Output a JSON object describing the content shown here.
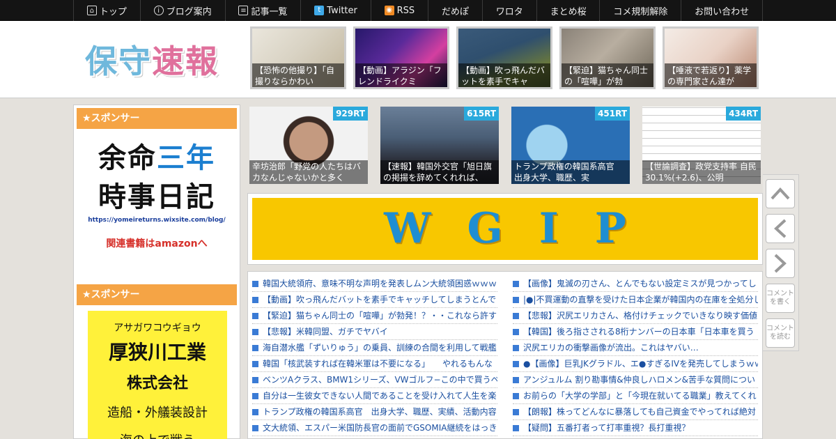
{
  "nav": [
    {
      "label": "トップ",
      "icon": "home-icon"
    },
    {
      "label": "ブログ案内",
      "icon": "info-icon"
    },
    {
      "label": "記事一覧",
      "icon": "list-icon"
    },
    {
      "label": "Twitter",
      "icon": "twitter-icon"
    },
    {
      "label": "RSS",
      "icon": "rss-icon"
    },
    {
      "label": "だめぽ"
    },
    {
      "label": "ワロタ"
    },
    {
      "label": "まとめ桜"
    },
    {
      "label": "コメ規制解除"
    },
    {
      "label": "お問い合わせ"
    }
  ],
  "logo": {
    "part1": "保守",
    "part2": "速報"
  },
  "header_thumbs": [
    {
      "caption": "【恐怖の他撮り】「自撮りならかわい"
    },
    {
      "caption": "【動画】アラジン「フレンドライクミ"
    },
    {
      "caption": "【動画】吹っ飛んだバットを素手でキャ"
    },
    {
      "caption": "【緊迫】猫ちゃん同士の「喧嘩」が勃"
    },
    {
      "caption": "【唾液で若返り】薬学の専門家さん達が"
    }
  ],
  "sidebar": {
    "sponsor_label": "★スポンサー",
    "ad1": {
      "line1a": "余命",
      "line1b": "三年",
      "line2": "時事日記",
      "url": "https://yomeireturns.wixsite.com/blog/",
      "link": "関連書籍はamazonへ"
    },
    "ad2": {
      "kana": "アサガワコウギョウ",
      "company": "厚狭川工業",
      "type": "株式会社",
      "service": "造船・外艤装設計",
      "extra": "海の上で戦う"
    }
  },
  "popular": [
    {
      "rt": "929RT",
      "caption": "辛坊治郎「野党の人たちはバカなんじゃないかと多く"
    },
    {
      "rt": "615RT",
      "caption": "【速報】韓国外交官「旭日旗の掲揚を辞めてくれれば、"
    },
    {
      "rt": "451RT",
      "caption": "トランプ政権の韓国系高官　出身大学、職歴、実"
    },
    {
      "rt": "434RT",
      "caption": "【世論調査】政党支持率 自民30.1%(+2.6)、公明"
    }
  ],
  "banner": {
    "text": "WGIP"
  },
  "news_left": [
    "韓国大統領府、意味不明な声明を発表しムン大統領困惑ｗｗｗ",
    "【動画】吹っ飛んだバットを素手でキャッチしてしまうとんで",
    "【緊迫】猫ちゃん同士の「喧嘩」が勃発！？・・これなら許す",
    "【悲報】米韓同盟、ガチでヤバイ",
    "海自潜水艦「ずいりゅう」の乗員、訓練の合間を利用して戦艦",
    "韓国「核武装すれば在韓米軍は不要になる」　　やれるもんな",
    "ベンツAクラス、BMW1シリーズ、VWゴルフ−この中で買うべ",
    "自分は一生彼女できない人間であることを受け入れて人生を楽",
    "トランプ政権の韓国系高官　出身大学、職歴、実績、活動内容",
    "文大統領、エスパー米国防長官の面前でGSOMIA継続をはっき"
  ],
  "news_right": [
    "【画像】鬼滅の刃さん、とんでもない設定ミスが見つかってし",
    "|●|不買運動の直撃を受けた日本企業が韓国内の在庫を全処分し",
    "【悲報】沢尻エリカさん、格付けチェックでいきなり映す価値",
    "【韓国】後ろ指さされる8桁ナンバーの日本車「日本車を買う",
    "沢尻エリカの衝撃画像が流出。これはヤバい…",
    "●【画像】巨乳JKグラドル、エ●すぎるIVを発売してしまうｗｗ",
    "アンジュルム 割り勘事情&仲良しハロメン&苦手な質問につい",
    "お前らの「大学の学部」と「今現在就いてる職業」教えてくれ",
    "【朗報】株ってどんなに暴落しても自己資金でやってれば絶対",
    "【疑問】五番打者って打率重視？長打重視？"
  ],
  "side_buttons": {
    "write_comment": "コメントを書く",
    "read_comment": "コメントを読む"
  }
}
